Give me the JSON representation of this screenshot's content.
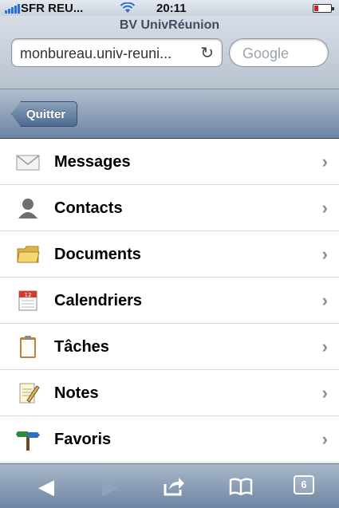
{
  "status_bar": {
    "carrier": "SFR REU...",
    "time": "20:11"
  },
  "browser": {
    "page_title": "BV UnivRéunion",
    "url": "monbureau.univ-reuni...",
    "search_placeholder": "Google"
  },
  "nav": {
    "back_label": "Quitter"
  },
  "menu": {
    "items": [
      {
        "label": "Messages",
        "icon": "envelope-icon"
      },
      {
        "label": "Contacts",
        "icon": "person-icon"
      },
      {
        "label": "Documents",
        "icon": "folder-icon"
      },
      {
        "label": "Calendriers",
        "icon": "calendar-icon"
      },
      {
        "label": "Tâches",
        "icon": "clipboard-icon"
      },
      {
        "label": "Notes",
        "icon": "notepad-icon"
      },
      {
        "label": "Favoris",
        "icon": "signpost-icon"
      }
    ]
  },
  "toolbar": {
    "tab_count": "6"
  },
  "colors": {
    "nav_gradient_top": "#b2bfcd",
    "nav_gradient_bottom": "#6d84a3",
    "battery": "#d21f1f"
  }
}
